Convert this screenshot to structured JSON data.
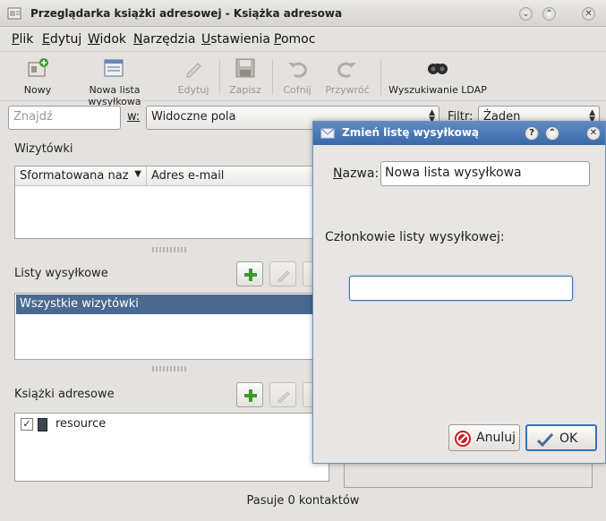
{
  "window": {
    "title": "Przeglądarka książki adresowej - Książka adresowa",
    "accent": "#3a69a8"
  },
  "menubar": {
    "items": [
      {
        "first": "P",
        "rest": "lik"
      },
      {
        "first": "E",
        "rest": "dytuj"
      },
      {
        "first": "W",
        "rest": "idok"
      },
      {
        "first": "N",
        "rest": "arzędzia"
      },
      {
        "first": "U",
        "rest": "stawienia"
      },
      {
        "first": "P",
        "rest": "omoc"
      }
    ]
  },
  "toolbar": {
    "new_label": "Nowy",
    "new_list_label": "Nowa lista wysyłkowa",
    "edit_label": "Edytuj",
    "save_label": "Zapisz",
    "undo_label": "Cofnij",
    "redo_label": "Przywróć",
    "ldap_label": "Wyszukiwanie LDAP"
  },
  "search": {
    "placeholder": "Znajdź",
    "in_label": "w:",
    "in_value": "Widoczne pola",
    "filter_label": "Filtr:",
    "filter_value": "Żaden"
  },
  "contacts": {
    "section_label": "Wizytówki",
    "columns": [
      "Sformatowana naz",
      "Adres e-mail"
    ]
  },
  "mailing_lists": {
    "section_label": "Listy wysyłkowe",
    "items": [
      "Wszystkie wizytówki"
    ]
  },
  "address_books": {
    "section_label": "Książki adresowe",
    "items": [
      {
        "label": "resource",
        "checked": true
      }
    ]
  },
  "status": {
    "text": "Pasuje 0 kontaktów"
  },
  "dialog": {
    "title": "Zmień listę wysyłkową",
    "name_label": "Nazwa:",
    "name_value": "Nowa lista wysyłkowa",
    "members_label": "Członkowie listy wysyłkowej:",
    "members_value": "",
    "cancel_label": "Anuluj",
    "ok_label": "OK"
  }
}
